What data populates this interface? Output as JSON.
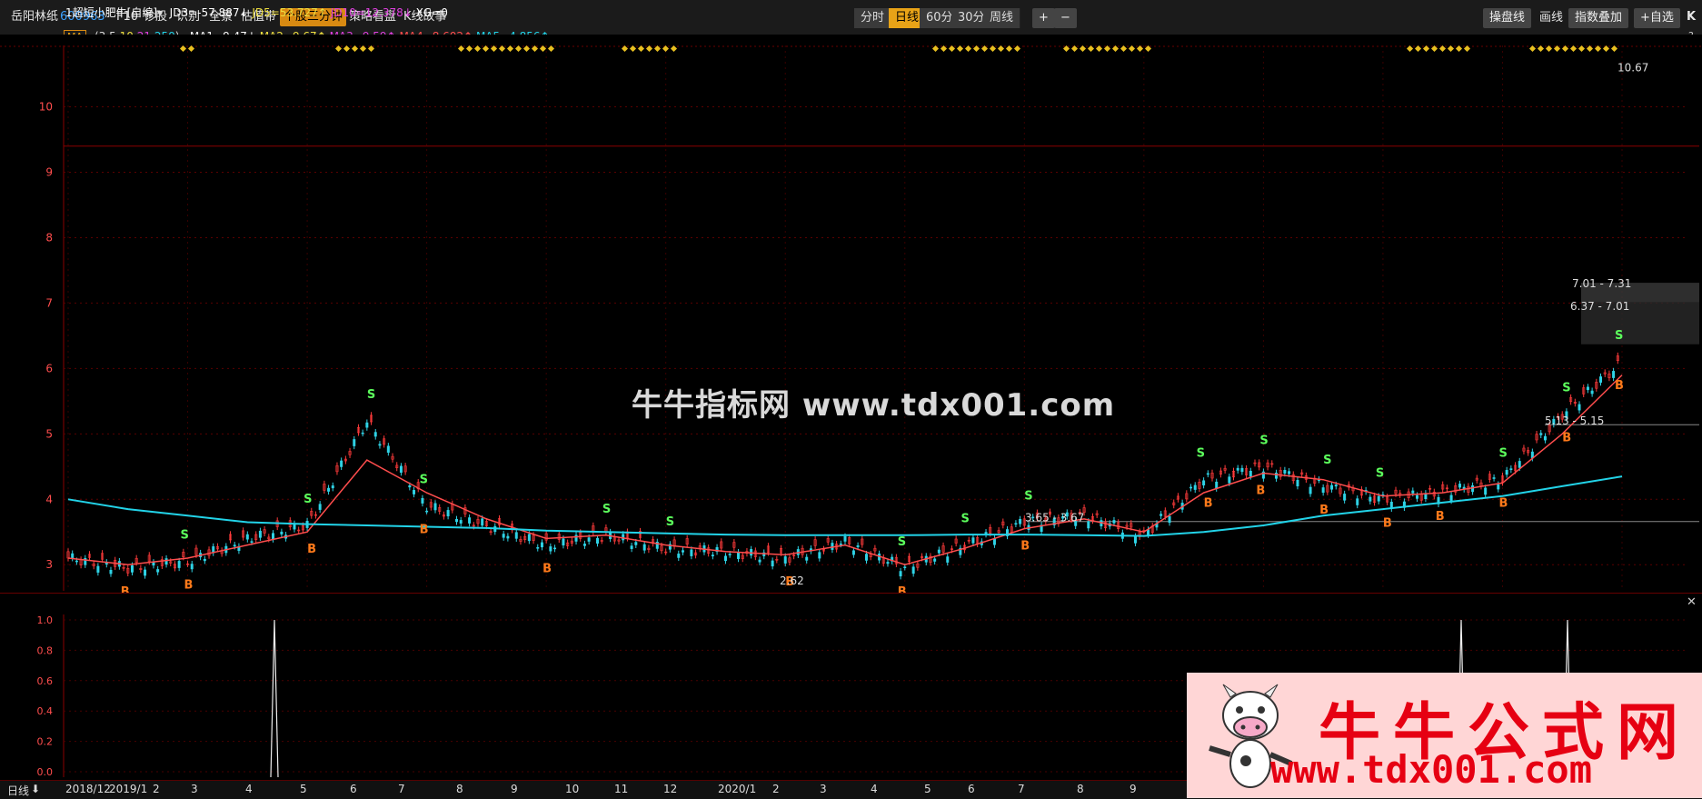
{
  "toolbar": {
    "stock_name": "岳阳林纸",
    "stock_code": "600963",
    "menu": [
      "F10",
      "诊股",
      "识别",
      "全景",
      "估值带",
      "个股三分钟",
      "策略看盘",
      "K线故事"
    ],
    "periods": [
      "分时",
      "日线",
      "60分",
      "30分",
      "周线"
    ],
    "zoom_in": "+",
    "zoom_out": "−",
    "right_buttons": [
      "操盘线",
      "画线",
      "指数叠加",
      "+自选"
    ],
    "k_label": "K"
  },
  "ma_bar": {
    "button": "MA",
    "params_open": "(3,5,",
    "param_10": "10",
    "param_sep1": ",",
    "param_21": "21",
    "param_sep2": ",",
    "param_250": "250",
    "params_close": ")",
    "ma1": "MA1=9.47↓",
    "ma2": "MA2=9.67↑",
    "ma3": "MA3=9.59↑",
    "ma4": "MA4=8.602↑",
    "ma5": "MA5=4.856↑",
    "help": "?"
  },
  "price_axis": [
    "10",
    "9",
    "8",
    "7",
    "6",
    "5",
    "4",
    "3"
  ],
  "annotations": {
    "high": "10.67",
    "low": "2.62",
    "z1": "7.01 - 7.31",
    "z2": "6.37 - 7.01",
    "z3": "5.13 - 5.15",
    "z4": "3.65 - 3.67"
  },
  "watermark": "牛牛指标网 www.tdx001.com",
  "sub_indicator": {
    "name": "1超短小肥牛[自编]",
    "jd3": "JD3=-57.887↓",
    "jd5": "JD5=53.727↑",
    "jd10": "JD10=12.378↓",
    "xg": "XG=0",
    "axis": [
      "1.0",
      "0.8",
      "0.6",
      "0.4",
      "0.2",
      "0.0"
    ]
  },
  "bottom": {
    "period_label": "日线",
    "dates": [
      "2018/12",
      "2019/1",
      "2",
      "3",
      "4",
      "5",
      "6",
      "7",
      "8",
      "9",
      "10",
      "11",
      "12",
      "2020/1",
      "2",
      "3",
      "4",
      "5",
      "6",
      "7",
      "8",
      "9"
    ]
  },
  "ad": {
    "title": "牛牛公式网",
    "url": "www.tdx001.com"
  },
  "colors": {
    "accent": "#e8a317",
    "up": "#ff3b3b",
    "down": "#2fd3e6",
    "ma_cyan": "#22d3e8",
    "ma_red": "#ff4d4d",
    "buy": "#ff7a1a",
    "sell": "#5cff5c"
  },
  "chart_data": {
    "type": "line",
    "title": "",
    "xlabel": "",
    "ylabel": "",
    "x": [
      "2018/12",
      "2019/1",
      "2019/2",
      "2019/3",
      "2019/4",
      "2019/5",
      "2019/6",
      "2019/7",
      "2019/8",
      "2019/9",
      "2019/10",
      "2019/11",
      "2019/12",
      "2020/1",
      "2020/2",
      "2020/3",
      "2020/4",
      "2020/5",
      "2020/6",
      "2020/7",
      "2020/8",
      "2020/9",
      "2020/10",
      "2020/11",
      "2020/12",
      "2021/1",
      "2021/2"
    ],
    "ylim": [
      2.6,
      10.8
    ],
    "series": [
      {
        "values": [
          3.1,
          2.95,
          3.05,
          3.4,
          3.6,
          5.2,
          3.9,
          3.6,
          3.3,
          3.45,
          3.25,
          3.2,
          3.1,
          3.35,
          2.95,
          3.3,
          3.65,
          3.75,
          3.45,
          4.3,
          4.5,
          4.2,
          4.0,
          4.1,
          4.3,
          5.3,
          6.1
        ]
      },
      {
        "values": [
          3.1,
          3.0,
          3.1,
          3.3,
          3.5,
          4.6,
          4.1,
          3.7,
          3.4,
          3.45,
          3.3,
          3.2,
          3.15,
          3.3,
          3.0,
          3.25,
          3.55,
          3.7,
          3.5,
          4.1,
          4.4,
          4.3,
          4.05,
          4.1,
          4.25,
          5.0,
          5.9
        ]
      },
      {
        "values": [
          4.0,
          3.85,
          3.75,
          3.65,
          3.62,
          3.6,
          3.58,
          3.56,
          3.52,
          3.5,
          3.48,
          3.46,
          3.45,
          3.45,
          3.45,
          3.46,
          3.46,
          3.45,
          3.44,
          3.5,
          3.6,
          3.75,
          3.85,
          3.95,
          4.05,
          4.2,
          4.35
        ]
      }
    ]
  }
}
